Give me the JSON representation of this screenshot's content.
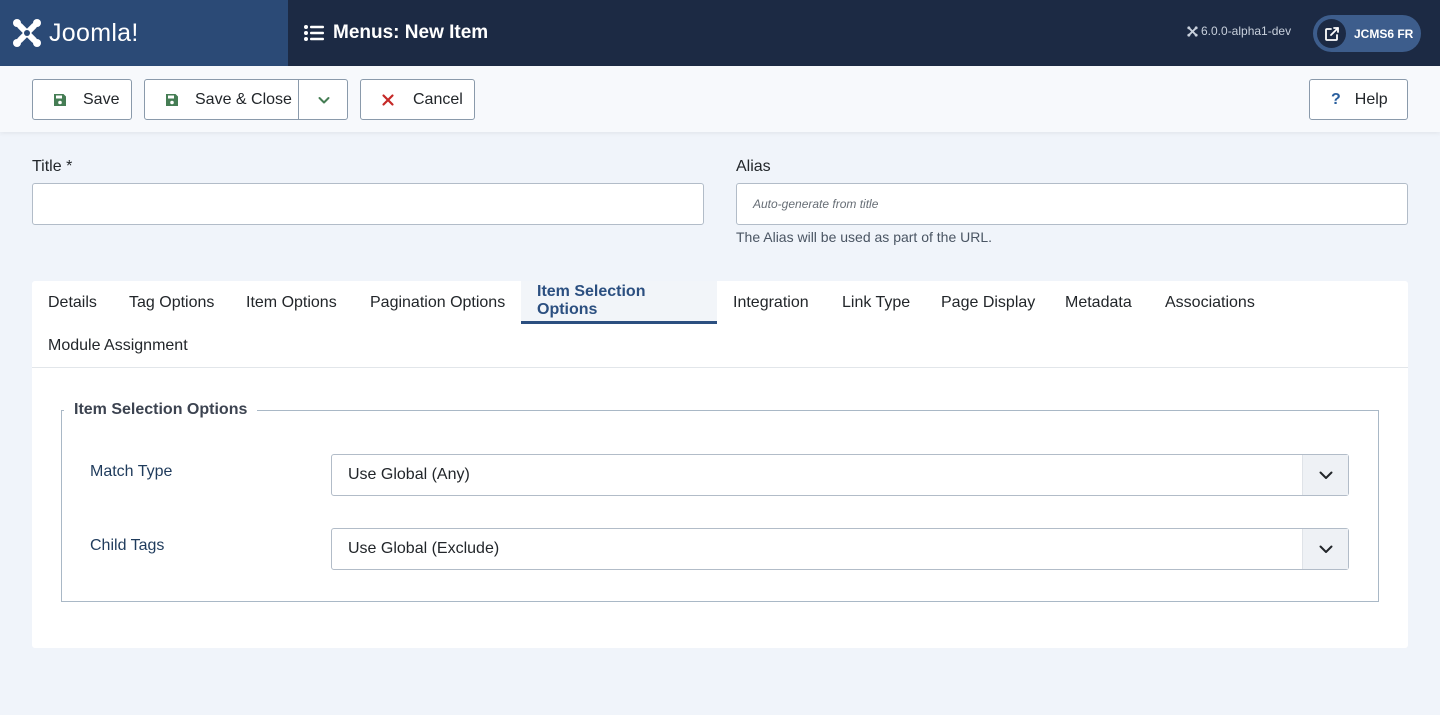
{
  "header": {
    "logo_text": "Joomla!",
    "page_title": "Menus: New Item",
    "version": "6.0.0-alpha1-dev",
    "site_button_label": "JCMS6 FR"
  },
  "toolbar": {
    "save_label": "Save",
    "save_close_label": "Save & Close",
    "cancel_label": "Cancel",
    "help_label": "Help",
    "help_icon": "?"
  },
  "form": {
    "title_label": "Title *",
    "title_value": "",
    "alias_label": "Alias",
    "alias_placeholder": "Auto-generate from title",
    "alias_hint": "The Alias will be used as part of the URL."
  },
  "tabs": [
    {
      "label": "Details"
    },
    {
      "label": "Tag Options"
    },
    {
      "label": "Item Options"
    },
    {
      "label": "Pagination Options"
    },
    {
      "label": "Item Selection Options",
      "active": true
    },
    {
      "label": "Integration"
    },
    {
      "label": "Link Type"
    },
    {
      "label": "Page Display"
    },
    {
      "label": "Metadata"
    },
    {
      "label": "Associations"
    },
    {
      "label": "Module Assignment"
    }
  ],
  "item_selection": {
    "legend": "Item Selection Options",
    "match_type_label": "Match Type",
    "match_type_value": "Use Global (Any)",
    "child_tags_label": "Child Tags",
    "child_tags_value": "Use Global (Exclude)"
  },
  "colors": {
    "header_bg": "#1c2a44",
    "logo_bg": "#2b4a76",
    "active_tab": "#2b4f80",
    "save_icon": "#457d54",
    "cancel_icon": "#c52827"
  }
}
